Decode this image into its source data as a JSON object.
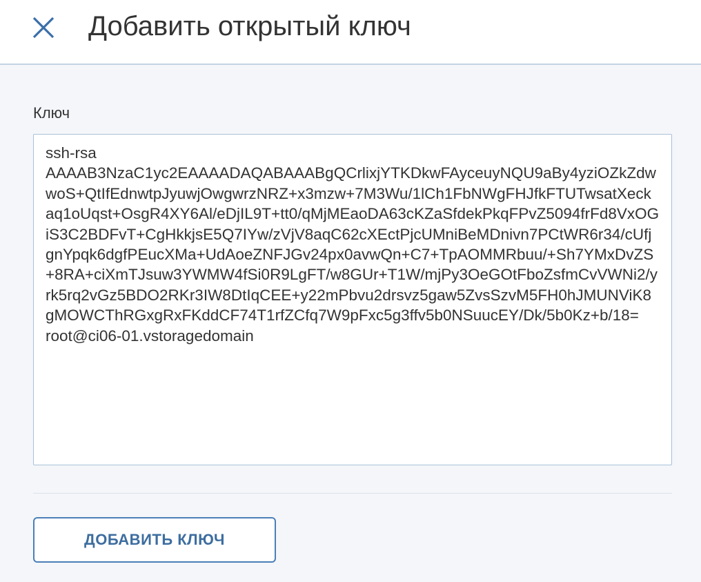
{
  "header": {
    "title": "Добавить открытый ключ",
    "close_icon": "close-icon"
  },
  "form": {
    "key_label": "Ключ",
    "key_value": "ssh-rsa\nAAAAB3NzaC1yc2EAAAADAQABAAABgQCrlixjYTKDkwFAyceuyNQU9aBy4yziOZkZdwwoS+QtIfEdnwtpJyuwjOwgwrzNRZ+x3mzw+7M3Wu/1lCh1FbNWgFHJfkFTUTwsatXeckaq1oUqst+OsgR4XY6Al/eDjIL9T+tt0/qMjMEaoDA63cKZaSfdekPkqFPvZ5094frFd8VxOGiS3C2BDFvT+CgHkkjsE5Q7IYw/zVjV8aqC62cXEctPjcUMniBeMDnivn7PCtWR6r34/cUfjgnYpqk6dgfPEucXMa+UdAoeZNFJGv24px0avwQn+C7+TpAOMMRbuu/+Sh7YMxDvZS+8RA+ciXmTJsuw3YWMW4fSi0R9LgFT/w8GUr+T1W/mjPy3OeGOtFboZsfmCvVWNi2/yrk5rq2vGz5BDO2RKr3IW8DtIqCEE+y22mPbvu2drsvz5gaw5ZvsSzvM5FH0hJMUNViK8gMOWCThRGxgRxFKddCF74T1rfZCfq7W9pFxc5g3ffv5b0NSuucEY/Dk/5b0Kz+b/18=\nroot@ci06-01.vstoragedomain"
  },
  "actions": {
    "add_key_label": "ДОБАВИТЬ КЛЮЧ"
  },
  "colors": {
    "accent": "#4a7fb8",
    "header_border": "#c3d3e4",
    "background": "#f4f6f9"
  }
}
